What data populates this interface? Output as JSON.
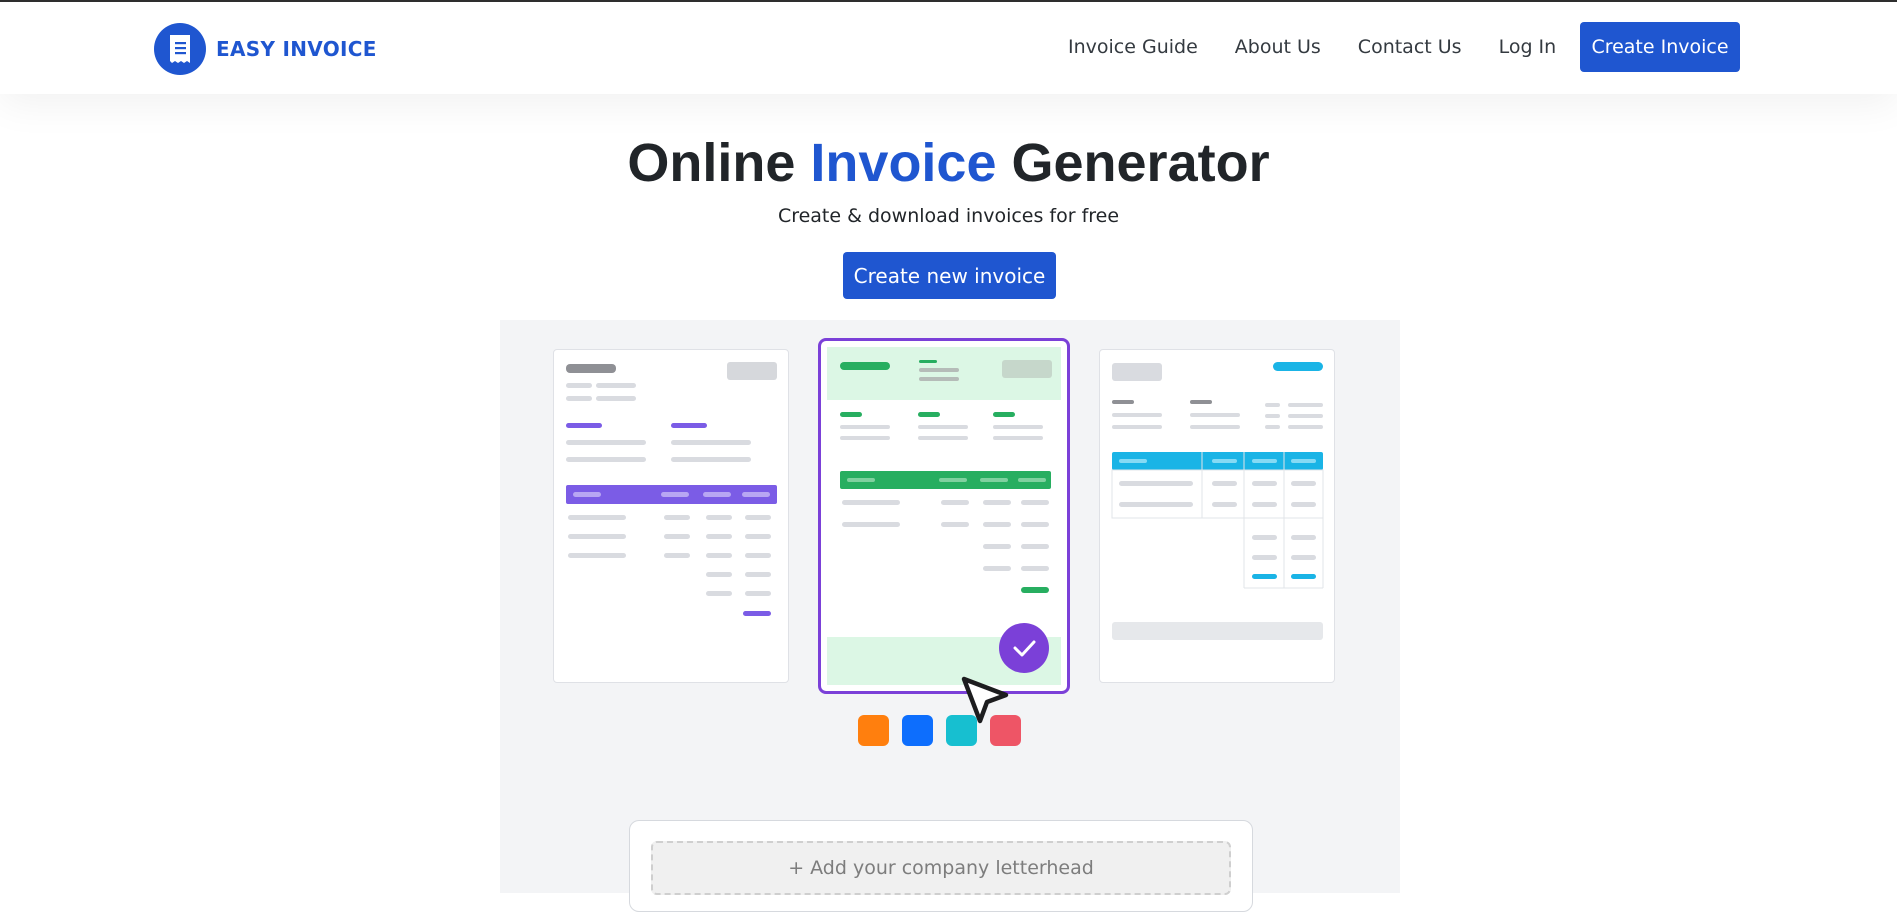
{
  "brand": {
    "name": "EASY INVOICE",
    "icon": "receipt-icon",
    "color": "#1f56d0"
  },
  "nav": {
    "links": [
      "Invoice Guide",
      "About Us",
      "Contact Us",
      "Log In"
    ],
    "cta": "Create Invoice"
  },
  "hero": {
    "title_pre": "Online ",
    "title_accent": "Invoice",
    "title_post": " Generator",
    "subtitle": "Create & download invoices for free",
    "button": "Create new invoice"
  },
  "templates": [
    {
      "accent": "#7b5ce6",
      "selected": false
    },
    {
      "accent": "#27ae60",
      "selected": true,
      "selected_icon": "check-icon",
      "selected_color": "#7b40d8"
    },
    {
      "accent": "#1ab4e6",
      "selected": false
    }
  ],
  "color_swatches": [
    "#ff7f0e",
    "#0d6efd",
    "#17bfd0",
    "#ee5566"
  ],
  "cursor_icon": "pointer-cursor-icon",
  "letterhead": {
    "label": "+ Add your company letterhead"
  },
  "colors": {
    "primary": "#1f56d0",
    "preview_bg": "#f3f4f6"
  }
}
